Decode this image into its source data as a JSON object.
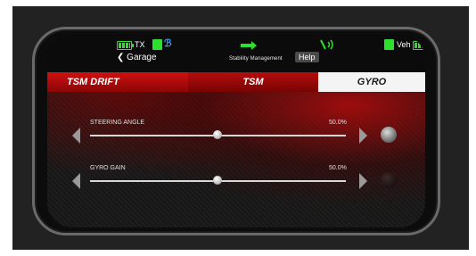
{
  "status_bar": {
    "tx_label": "TX",
    "veh_label": "Veh",
    "back_label": "Garage",
    "screen_title": "Stability Management",
    "help_label": "Help",
    "icons": [
      "tx-battery-icon",
      "signal-icon",
      "bluetooth-icon",
      "swap-arrows-icon",
      "antenna-icon",
      "vehicle-icon",
      "veh-battery-icon"
    ]
  },
  "tabs": [
    {
      "label": "TSM DRIFT",
      "active": false
    },
    {
      "label": "TSM",
      "active": false
    },
    {
      "label": "GYRO",
      "active": true
    }
  ],
  "sliders": [
    {
      "label": "STEERING ANGLE",
      "value_text": "50.0%",
      "value": 50.0
    },
    {
      "label": "GYRO GAIN",
      "value_text": "50.0%",
      "value": 50.0
    }
  ],
  "colors": {
    "accent_red": "#c00a0a",
    "battery_green": "#2ee02e",
    "bluetooth_blue": "#3a9cff"
  }
}
